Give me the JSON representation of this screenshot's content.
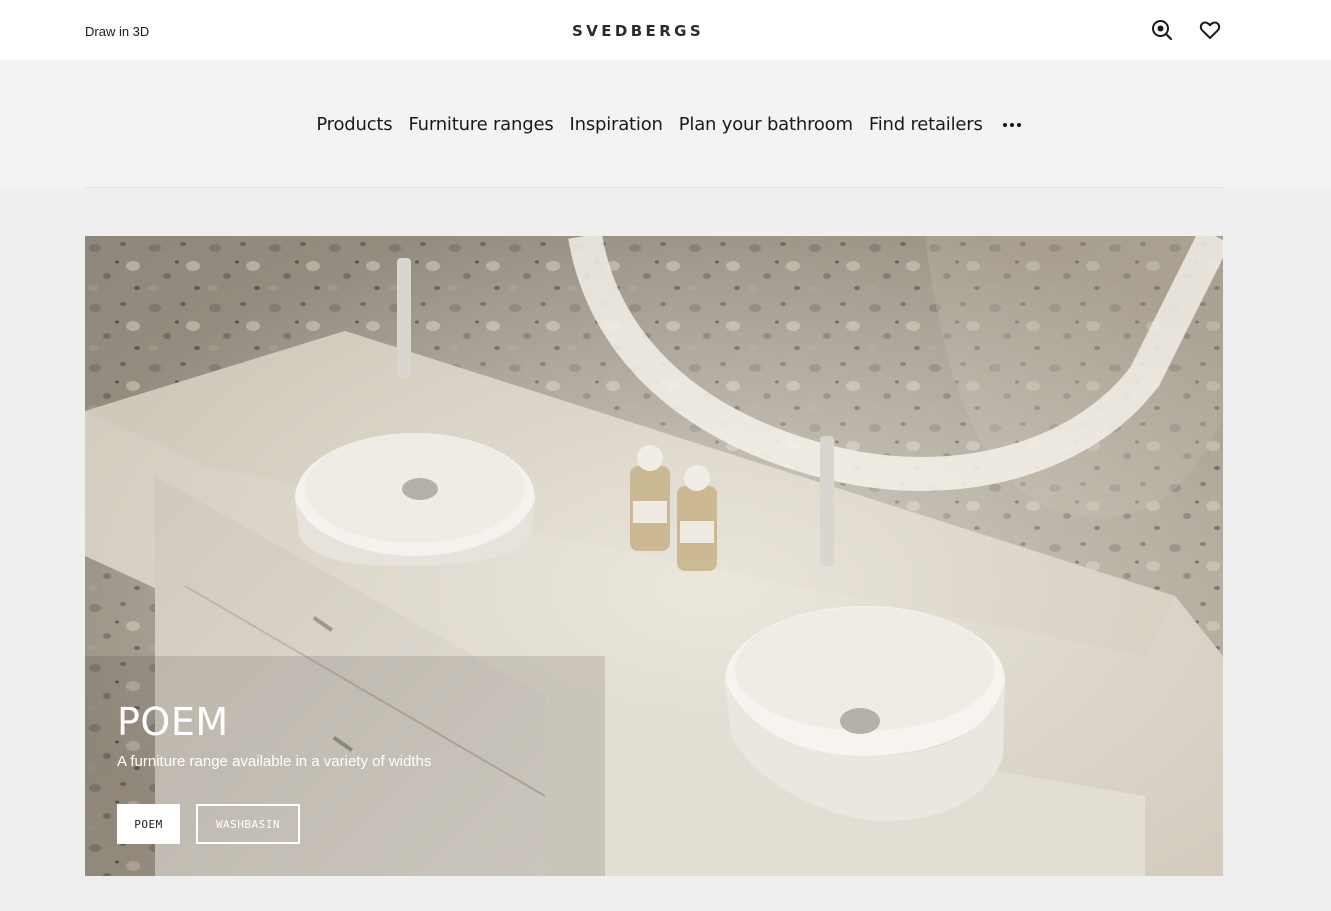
{
  "header": {
    "draw_link": "Draw in 3D",
    "logo": "SVEDBERGS",
    "search_icon": "search-icon",
    "favorites_icon": "heart-icon"
  },
  "nav": {
    "items": [
      {
        "label": "Products"
      },
      {
        "label": "Furniture ranges"
      },
      {
        "label": "Inspiration"
      },
      {
        "label": "Plan your bathroom"
      },
      {
        "label": "Find retailers"
      }
    ],
    "more_icon": "more-dots-icon"
  },
  "hero": {
    "title": "POEM",
    "subtitle": "A furniture range available in a variety of widths",
    "buttons": [
      {
        "label": "POEM"
      },
      {
        "label": "WASHBASIN"
      }
    ],
    "colors": {
      "wall": "#a39a8c",
      "counter": "#d6cfc2",
      "cabinet": "#ddd8cf",
      "basin": "#f2efea"
    }
  },
  "colors": {
    "header_bg": "#ffffff",
    "nav_bg": "#f3f3f3",
    "page_bg": "#efefef",
    "text": "#1a1a1a"
  }
}
